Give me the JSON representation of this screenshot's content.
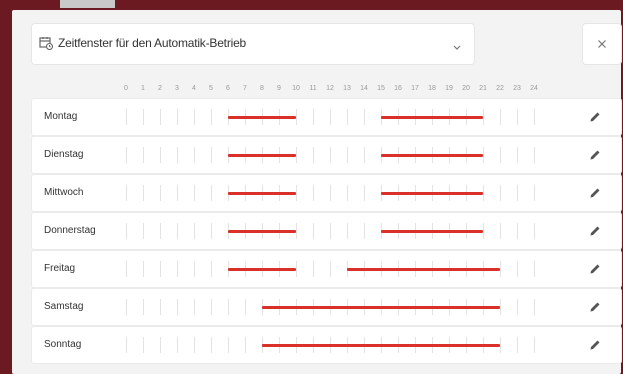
{
  "header": {
    "title": "Zeitfenster für den Automatik-Betrieb",
    "icons": {
      "calendar": "calendar-clock-icon",
      "chevron": "chevron-down-icon",
      "close": "close-icon",
      "edit": "pencil-icon"
    }
  },
  "hours": [
    "0",
    "1",
    "2",
    "3",
    "4",
    "5",
    "6",
    "7",
    "8",
    "9",
    "10",
    "11",
    "12",
    "13",
    "14",
    "15",
    "16",
    "17",
    "18",
    "19",
    "20",
    "21",
    "22",
    "23",
    "24"
  ],
  "colors": {
    "segment": "#d9302a",
    "frame": "#6b1a22"
  },
  "schedule": [
    {
      "day": "Montag",
      "windows": [
        [
          6,
          10
        ],
        [
          15,
          21
        ]
      ]
    },
    {
      "day": "Dienstag",
      "windows": [
        [
          6,
          10
        ],
        [
          15,
          21
        ]
      ]
    },
    {
      "day": "Mittwoch",
      "windows": [
        [
          6,
          10
        ],
        [
          15,
          21
        ]
      ]
    },
    {
      "day": "Donnerstag",
      "windows": [
        [
          6,
          10
        ],
        [
          15,
          21
        ]
      ]
    },
    {
      "day": "Freitag",
      "windows": [
        [
          6,
          10
        ],
        [
          13,
          22
        ]
      ]
    },
    {
      "day": "Samstag",
      "windows": [
        [
          8,
          22
        ]
      ]
    },
    {
      "day": "Sonntag",
      "windows": [
        [
          8,
          22
        ]
      ]
    }
  ]
}
